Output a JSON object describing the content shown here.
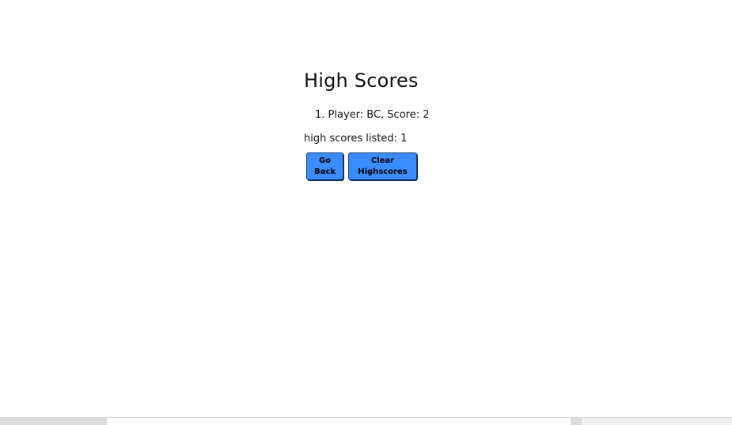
{
  "page": {
    "title": "High Scores",
    "scores": [
      {
        "text": "1. Player: BC, Score: 2"
      }
    ],
    "count_text": "high scores listed: 1",
    "buttons": {
      "go_back": [
        "Go",
        "Back"
      ],
      "clear": [
        "Clear",
        "Highscores"
      ]
    }
  },
  "colors": {
    "button_bg": "#3b8cff",
    "background": "#ffffff"
  }
}
